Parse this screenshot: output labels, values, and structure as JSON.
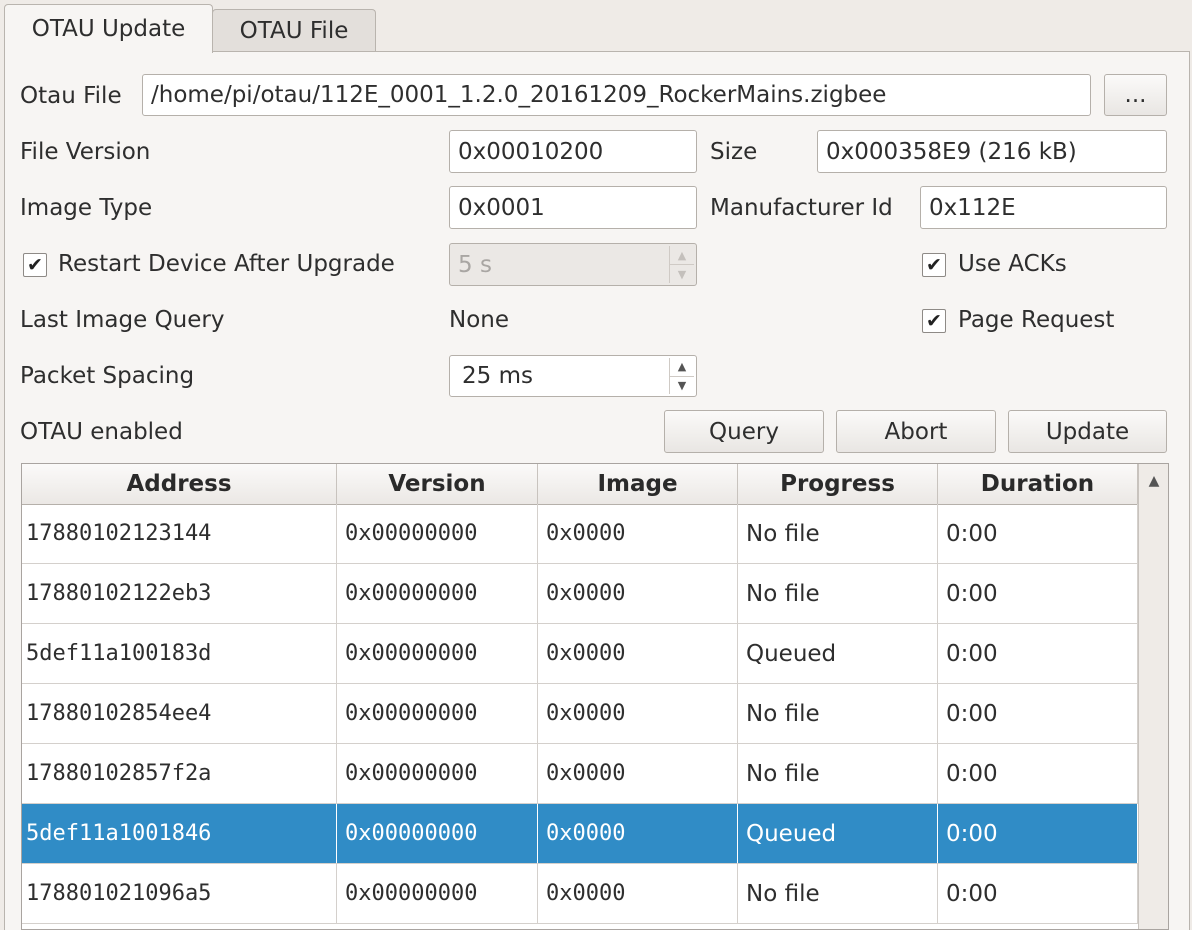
{
  "tabs": [
    {
      "label": "OTAU Update",
      "active": true
    },
    {
      "label": "OTAU File",
      "active": false
    }
  ],
  "form": {
    "otau_file_label": "Otau File",
    "otau_file_value": "/home/pi/otau/112E_0001_1.2.0_20161209_RockerMains.zigbee",
    "browse_label": "...",
    "file_version_label": "File Version",
    "file_version_value": "0x00010200",
    "size_label": "Size",
    "size_value": "0x000358E9 (216 kB)",
    "image_type_label": "Image Type",
    "image_type_value": "0x0001",
    "manufacturer_id_label": "Manufacturer Id",
    "manufacturer_id_value": "0x112E",
    "restart_label": "Restart Device After Upgrade",
    "restart_checked": true,
    "restart_delay_value": "5 s",
    "use_acks_label": "Use ACKs",
    "use_acks_checked": true,
    "last_image_query_label": "Last Image Query",
    "last_image_query_value": "None",
    "page_request_label": "Page Request",
    "page_request_checked": true,
    "packet_spacing_label": "Packet Spacing",
    "packet_spacing_value": "25 ms",
    "status_label": "OTAU enabled",
    "query_label": "Query",
    "abort_label": "Abort",
    "update_label": "Update",
    "checkmark": "✔"
  },
  "table": {
    "columns": [
      "Address",
      "Version",
      "Image",
      "Progress",
      "Duration"
    ],
    "rows": [
      {
        "address": "17880102123144",
        "version": "0x00000000",
        "image": "0x0000",
        "progress": "No file",
        "duration": "0:00",
        "selected": false
      },
      {
        "address": "17880102122eb3",
        "version": "0x00000000",
        "image": "0x0000",
        "progress": "No file",
        "duration": "0:00",
        "selected": false
      },
      {
        "address": "5def11a100183d",
        "version": "0x00000000",
        "image": "0x0000",
        "progress": "Queued",
        "duration": "0:00",
        "selected": false
      },
      {
        "address": "17880102854ee4",
        "version": "0x00000000",
        "image": "0x0000",
        "progress": "No file",
        "duration": "0:00",
        "selected": false
      },
      {
        "address": "17880102857f2a",
        "version": "0x00000000",
        "image": "0x0000",
        "progress": "No file",
        "duration": "0:00",
        "selected": false
      },
      {
        "address": "5def11a1001846",
        "version": "0x00000000",
        "image": "0x0000",
        "progress": "Queued",
        "duration": "0:00",
        "selected": true
      },
      {
        "address": "178801021096a5",
        "version": "0x00000000",
        "image": "0x0000",
        "progress": "No file",
        "duration": "0:00",
        "selected": false
      }
    ]
  },
  "icons": {
    "spin_up": "▲",
    "spin_down": "▼",
    "scroll_up": "▲"
  },
  "colors": {
    "selection": "#308cc6",
    "window_bg": "#efebe7"
  }
}
